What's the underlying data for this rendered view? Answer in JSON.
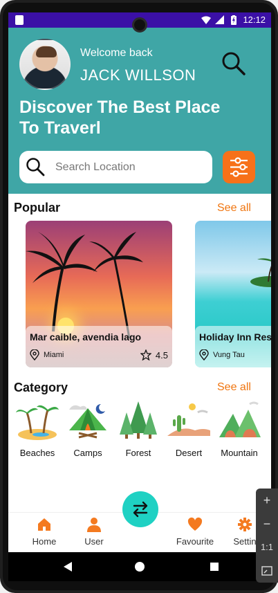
{
  "statusbar": {
    "time": "12:12"
  },
  "header": {
    "welcome": "Welcome back",
    "username": "JACK WILLSON",
    "headline": "Discover The Best Place To Traverl",
    "search_placeholder": "Search Location"
  },
  "popular": {
    "title": "Popular",
    "see_all": "See all",
    "cards": [
      {
        "name": "Mar caible, avendia lago",
        "location": "Miami",
        "rating": "4.5"
      },
      {
        "name": "Holiday Inn Reso",
        "location": "Vung Tau"
      }
    ]
  },
  "category": {
    "title": "Category",
    "see_all": "See all",
    "items": [
      "Beaches",
      "Camps",
      "Forest",
      "Desert",
      "Mountain"
    ]
  },
  "nav": {
    "home": "Home",
    "user": "User",
    "favourite": "Favourite",
    "settings": "Settin"
  },
  "zoom": {
    "plus": "+",
    "minus": "−",
    "ratio": "1:1"
  },
  "colors": {
    "teal": "#3fa6a6",
    "orange": "#f77119",
    "fab": "#1fd1c3",
    "statusbar": "#3b10a6"
  }
}
